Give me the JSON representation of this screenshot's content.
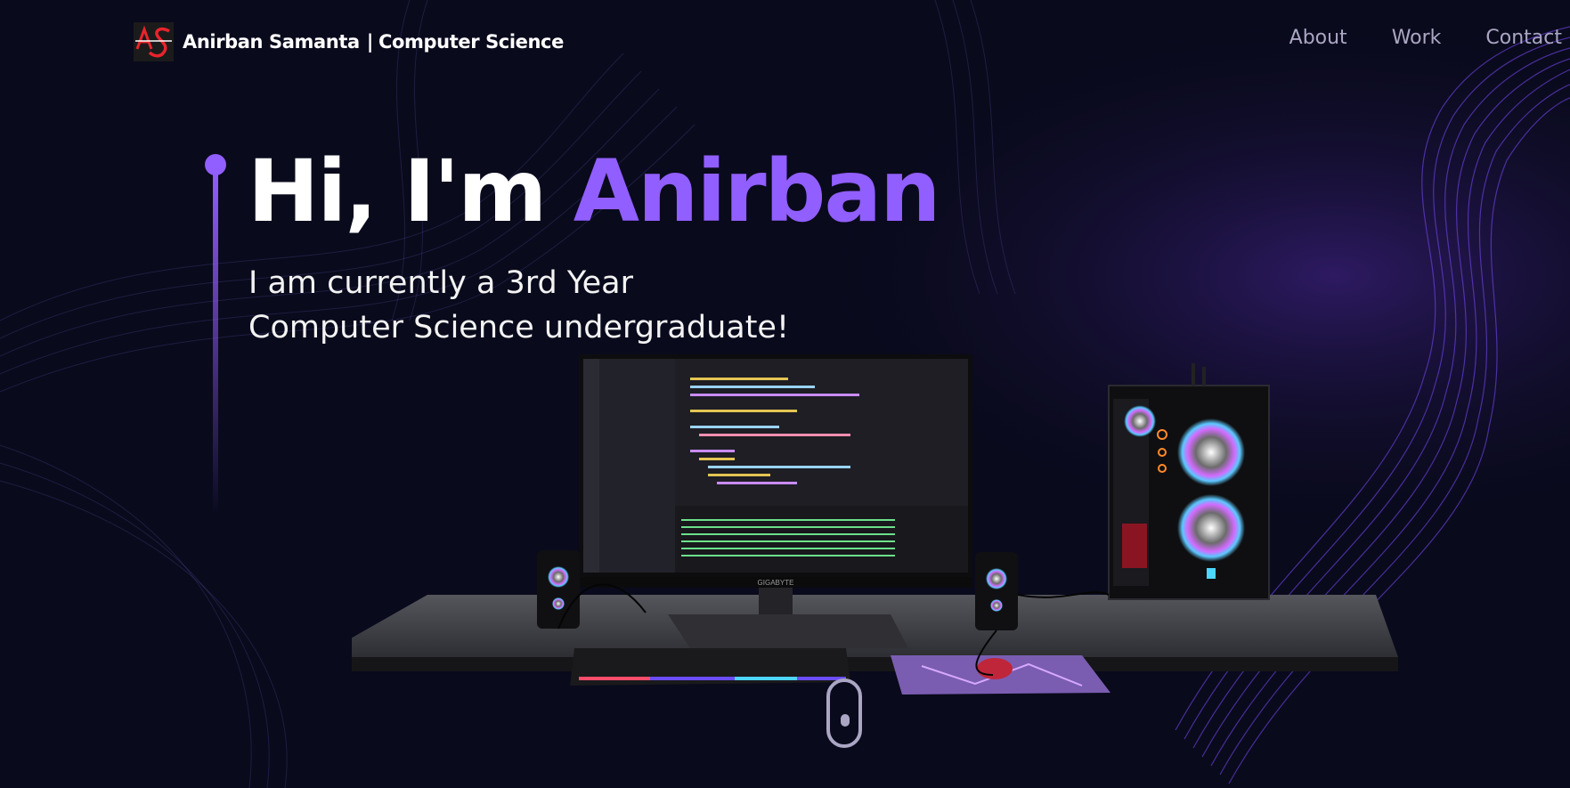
{
  "header": {
    "logo_text": "AS",
    "brand_name": "Anirban Samanta",
    "brand_separator": "|",
    "brand_subtitle": "Computer Science",
    "nav": [
      {
        "label": "About"
      },
      {
        "label": "Work"
      },
      {
        "label": "Contact"
      }
    ]
  },
  "hero": {
    "greeting": "Hi, I'm",
    "name": "Anirban",
    "subtitle_line1": "I am currently a 3rd Year",
    "subtitle_line2": "Computer Science undergraduate!"
  },
  "scene": {
    "monitor_brand": "GIGABYTE"
  },
  "colors": {
    "background": "#090a1c",
    "accent": "#915eff",
    "nav_text": "#aaa6c3",
    "heading": "#ffffff",
    "logo_red": "#e8242c"
  },
  "icons": [
    "logo-mark",
    "mouse-scroll-icon"
  ]
}
